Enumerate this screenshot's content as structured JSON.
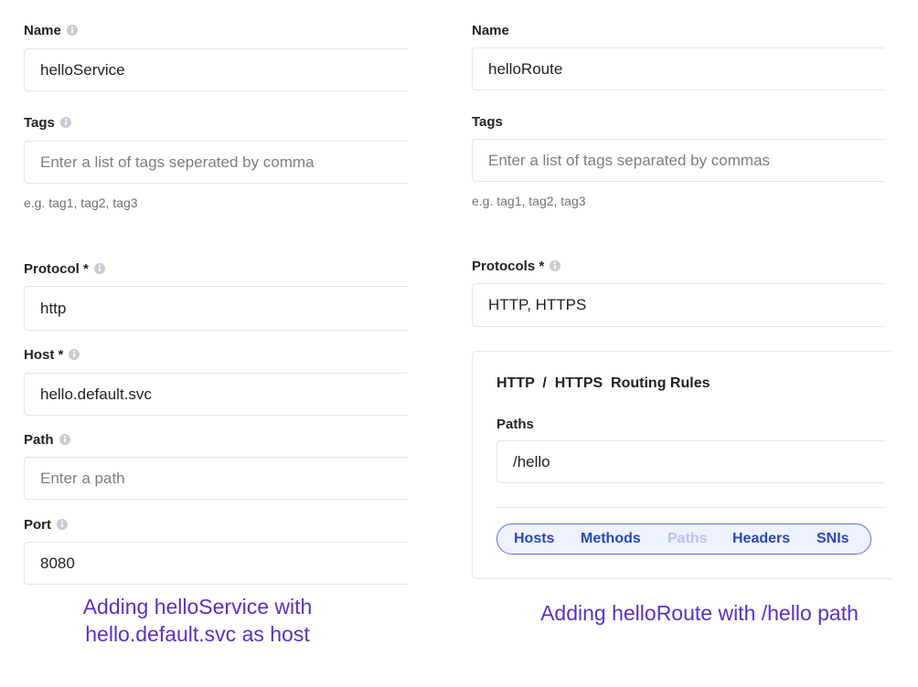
{
  "left": {
    "name_label": "Name",
    "name_value": "helloService",
    "tags_label": "Tags",
    "tags_placeholder": "Enter a list of tags seperated by comma",
    "tags_hint": "e.g. tag1, tag2, tag3",
    "protocol_label": "Protocol *",
    "protocol_value": "http",
    "host_label": "Host *",
    "host_value": "hello.default.svc",
    "path_label": "Path",
    "path_placeholder": "Enter a path",
    "port_label": "Port",
    "port_value": "8080",
    "caption_line1": "Adding helloService with",
    "caption_line2": "hello.default.svc as host"
  },
  "right": {
    "name_label": "Name",
    "name_value": "helloRoute",
    "tags_label": "Tags",
    "tags_placeholder": "Enter a list of tags separated by commas",
    "tags_hint": "e.g. tag1, tag2, tag3",
    "protocols_label": "Protocols *",
    "protocols_value": "HTTP, HTTPS",
    "rules_title": "HTTP  /  HTTPS  Routing Rules",
    "paths_label": "Paths",
    "paths_value": "/hello",
    "tabs": [
      "Hosts",
      "Methods",
      "Paths",
      "Headers",
      "SNIs"
    ],
    "caption": "Adding helloRoute with /hello path"
  },
  "colors": {
    "caption": "#5b2fc9",
    "pill_border": "#5a6ed6",
    "pill_text": "#2a47b8"
  },
  "icons": {
    "info": "info-circle-icon"
  }
}
